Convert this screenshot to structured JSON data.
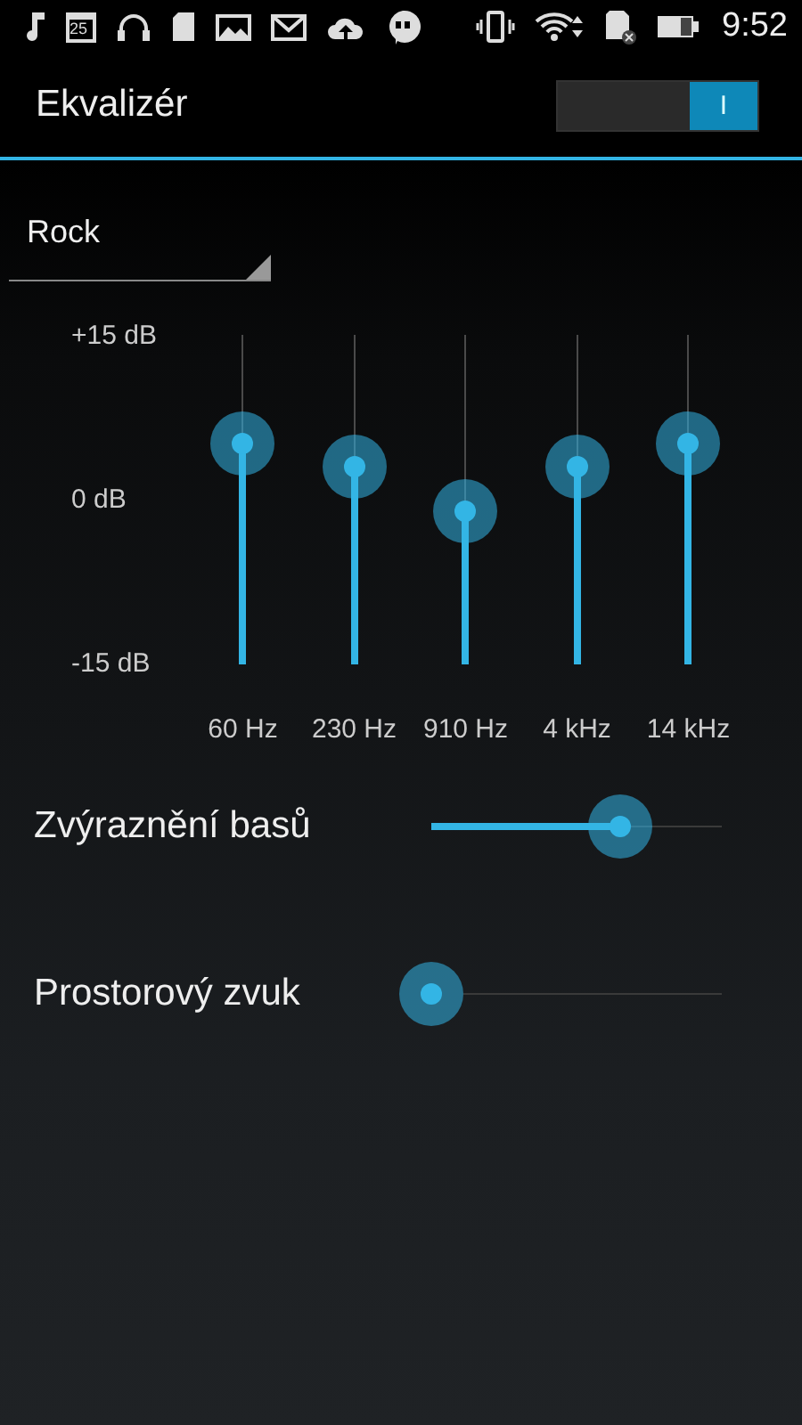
{
  "status_bar": {
    "calendar_day": "25",
    "time": "9:52"
  },
  "header": {
    "title": "Ekvalizér",
    "toggle": {
      "on": true,
      "label": "I"
    }
  },
  "preset": {
    "value": "Rock"
  },
  "equalizer": {
    "scale": [
      "+15 dB",
      "0 dB",
      "-15 dB"
    ],
    "bands": [
      {
        "frequency": "60 Hz",
        "level": 0.67
      },
      {
        "frequency": "230 Hz",
        "level": 0.6
      },
      {
        "frequency": "910 Hz",
        "level": 0.465
      },
      {
        "frequency": "4 kHz",
        "level": 0.6
      },
      {
        "frequency": "14 kHz",
        "level": 0.67
      }
    ]
  },
  "effects": [
    {
      "name": "Zvýraznění basů",
      "level": 0.65
    },
    {
      "name": "Prostorový zvuk"
    }
  ]
}
